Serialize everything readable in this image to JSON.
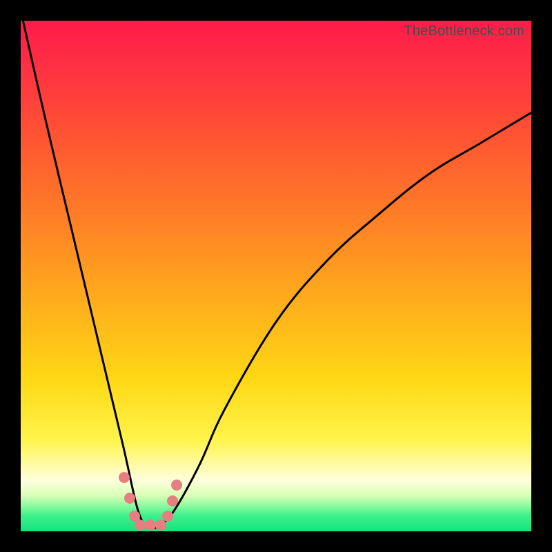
{
  "watermark": "TheBottleneck.com",
  "chart_data": {
    "type": "line",
    "title": "",
    "xlabel": "",
    "ylabel": "",
    "xlim": [
      0,
      100
    ],
    "ylim": [
      0,
      100
    ],
    "grid": false,
    "legend": false,
    "series": [
      {
        "name": "bottleneck-curve",
        "x": [
          0,
          5,
          10,
          15,
          20,
          23,
          25,
          27,
          30,
          35,
          40,
          50,
          60,
          70,
          80,
          90,
          100
        ],
        "y": [
          102,
          80,
          59,
          38,
          17,
          4,
          1,
          1,
          4,
          13,
          24,
          41,
          53,
          62,
          70,
          76,
          82
        ]
      }
    ],
    "markers": {
      "name": "highlight-dots",
      "color": "#e77e82",
      "points": [
        {
          "x": 20.3,
          "y": 10.5
        },
        {
          "x": 21.4,
          "y": 6.5
        },
        {
          "x": 22.3,
          "y": 3.0
        },
        {
          "x": 23.4,
          "y": 1.2
        },
        {
          "x": 25.4,
          "y": 1.2
        },
        {
          "x": 27.4,
          "y": 1.2
        },
        {
          "x": 28.8,
          "y": 3.0
        },
        {
          "x": 29.7,
          "y": 6.0
        },
        {
          "x": 30.6,
          "y": 9.0
        }
      ]
    },
    "background_gradient": [
      "#ff1b4a",
      "#ff7d26",
      "#fff44a",
      "#16e37e"
    ]
  }
}
